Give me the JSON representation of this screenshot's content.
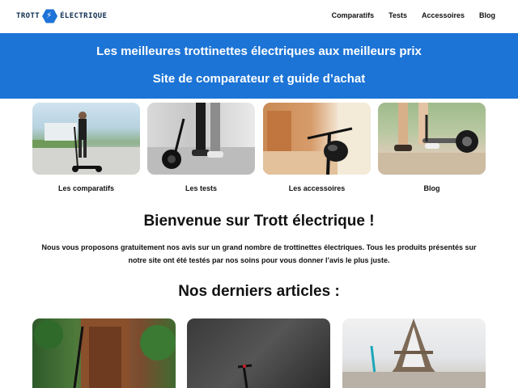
{
  "header": {
    "logo_left": "TROTT",
    "logo_right": "ÉLECTRIQUE",
    "nav": [
      "Comparatifs",
      "Tests",
      "Accessoires",
      "Blog"
    ]
  },
  "banner": {
    "line1": "Les meilleures trottinettes électriques aux meilleurs prix",
    "line2": "Site de comparateur et guide d’achat"
  },
  "categories": [
    {
      "label": "Les comparatifs"
    },
    {
      "label": "Les tests"
    },
    {
      "label": "Les accessoires"
    },
    {
      "label": "Blog"
    }
  ],
  "welcome": {
    "title": "Bienvenue sur Trott électrique !",
    "text": "Nous vous proposons gratuitement nos avis sur un grand nombre de trottinettes électriques. Tous les produits présentés sur notre site ont été testés par nos soins pour vous donner l’avis le plus juste."
  },
  "articles": {
    "title": "Nos derniers articles :"
  },
  "colors": {
    "brand": "#1c74d6",
    "logo_dark": "#0d2d4e"
  }
}
